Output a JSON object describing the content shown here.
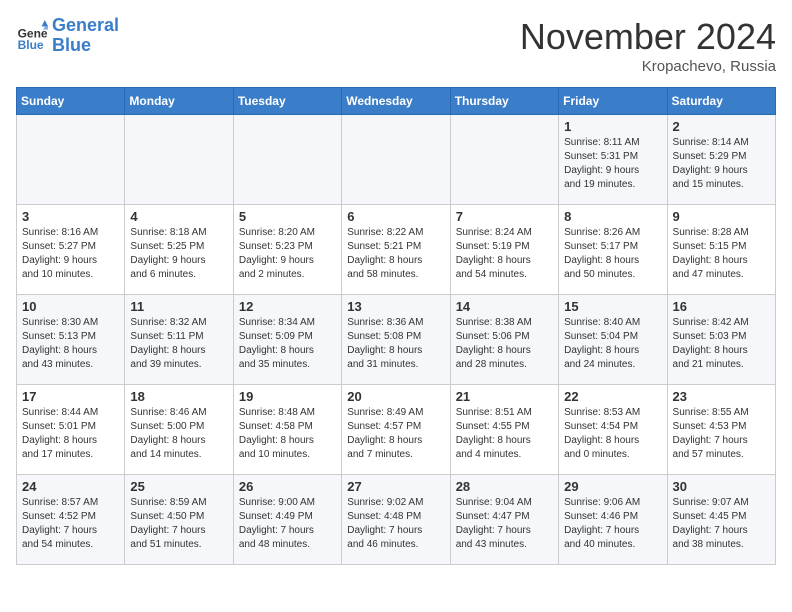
{
  "header": {
    "logo_line1": "General",
    "logo_line2": "Blue",
    "month": "November 2024",
    "location": "Kropachevo, Russia"
  },
  "days_of_week": [
    "Sunday",
    "Monday",
    "Tuesday",
    "Wednesday",
    "Thursday",
    "Friday",
    "Saturday"
  ],
  "weeks": [
    [
      {
        "day": "",
        "info": ""
      },
      {
        "day": "",
        "info": ""
      },
      {
        "day": "",
        "info": ""
      },
      {
        "day": "",
        "info": ""
      },
      {
        "day": "",
        "info": ""
      },
      {
        "day": "1",
        "info": "Sunrise: 8:11 AM\nSunset: 5:31 PM\nDaylight: 9 hours\nand 19 minutes."
      },
      {
        "day": "2",
        "info": "Sunrise: 8:14 AM\nSunset: 5:29 PM\nDaylight: 9 hours\nand 15 minutes."
      }
    ],
    [
      {
        "day": "3",
        "info": "Sunrise: 8:16 AM\nSunset: 5:27 PM\nDaylight: 9 hours\nand 10 minutes."
      },
      {
        "day": "4",
        "info": "Sunrise: 8:18 AM\nSunset: 5:25 PM\nDaylight: 9 hours\nand 6 minutes."
      },
      {
        "day": "5",
        "info": "Sunrise: 8:20 AM\nSunset: 5:23 PM\nDaylight: 9 hours\nand 2 minutes."
      },
      {
        "day": "6",
        "info": "Sunrise: 8:22 AM\nSunset: 5:21 PM\nDaylight: 8 hours\nand 58 minutes."
      },
      {
        "day": "7",
        "info": "Sunrise: 8:24 AM\nSunset: 5:19 PM\nDaylight: 8 hours\nand 54 minutes."
      },
      {
        "day": "8",
        "info": "Sunrise: 8:26 AM\nSunset: 5:17 PM\nDaylight: 8 hours\nand 50 minutes."
      },
      {
        "day": "9",
        "info": "Sunrise: 8:28 AM\nSunset: 5:15 PM\nDaylight: 8 hours\nand 47 minutes."
      }
    ],
    [
      {
        "day": "10",
        "info": "Sunrise: 8:30 AM\nSunset: 5:13 PM\nDaylight: 8 hours\nand 43 minutes."
      },
      {
        "day": "11",
        "info": "Sunrise: 8:32 AM\nSunset: 5:11 PM\nDaylight: 8 hours\nand 39 minutes."
      },
      {
        "day": "12",
        "info": "Sunrise: 8:34 AM\nSunset: 5:09 PM\nDaylight: 8 hours\nand 35 minutes."
      },
      {
        "day": "13",
        "info": "Sunrise: 8:36 AM\nSunset: 5:08 PM\nDaylight: 8 hours\nand 31 minutes."
      },
      {
        "day": "14",
        "info": "Sunrise: 8:38 AM\nSunset: 5:06 PM\nDaylight: 8 hours\nand 28 minutes."
      },
      {
        "day": "15",
        "info": "Sunrise: 8:40 AM\nSunset: 5:04 PM\nDaylight: 8 hours\nand 24 minutes."
      },
      {
        "day": "16",
        "info": "Sunrise: 8:42 AM\nSunset: 5:03 PM\nDaylight: 8 hours\nand 21 minutes."
      }
    ],
    [
      {
        "day": "17",
        "info": "Sunrise: 8:44 AM\nSunset: 5:01 PM\nDaylight: 8 hours\nand 17 minutes."
      },
      {
        "day": "18",
        "info": "Sunrise: 8:46 AM\nSunset: 5:00 PM\nDaylight: 8 hours\nand 14 minutes."
      },
      {
        "day": "19",
        "info": "Sunrise: 8:48 AM\nSunset: 4:58 PM\nDaylight: 8 hours\nand 10 minutes."
      },
      {
        "day": "20",
        "info": "Sunrise: 8:49 AM\nSunset: 4:57 PM\nDaylight: 8 hours\nand 7 minutes."
      },
      {
        "day": "21",
        "info": "Sunrise: 8:51 AM\nSunset: 4:55 PM\nDaylight: 8 hours\nand 4 minutes."
      },
      {
        "day": "22",
        "info": "Sunrise: 8:53 AM\nSunset: 4:54 PM\nDaylight: 8 hours\nand 0 minutes."
      },
      {
        "day": "23",
        "info": "Sunrise: 8:55 AM\nSunset: 4:53 PM\nDaylight: 7 hours\nand 57 minutes."
      }
    ],
    [
      {
        "day": "24",
        "info": "Sunrise: 8:57 AM\nSunset: 4:52 PM\nDaylight: 7 hours\nand 54 minutes."
      },
      {
        "day": "25",
        "info": "Sunrise: 8:59 AM\nSunset: 4:50 PM\nDaylight: 7 hours\nand 51 minutes."
      },
      {
        "day": "26",
        "info": "Sunrise: 9:00 AM\nSunset: 4:49 PM\nDaylight: 7 hours\nand 48 minutes."
      },
      {
        "day": "27",
        "info": "Sunrise: 9:02 AM\nSunset: 4:48 PM\nDaylight: 7 hours\nand 46 minutes."
      },
      {
        "day": "28",
        "info": "Sunrise: 9:04 AM\nSunset: 4:47 PM\nDaylight: 7 hours\nand 43 minutes."
      },
      {
        "day": "29",
        "info": "Sunrise: 9:06 AM\nSunset: 4:46 PM\nDaylight: 7 hours\nand 40 minutes."
      },
      {
        "day": "30",
        "info": "Sunrise: 9:07 AM\nSunset: 4:45 PM\nDaylight: 7 hours\nand 38 minutes."
      }
    ]
  ]
}
